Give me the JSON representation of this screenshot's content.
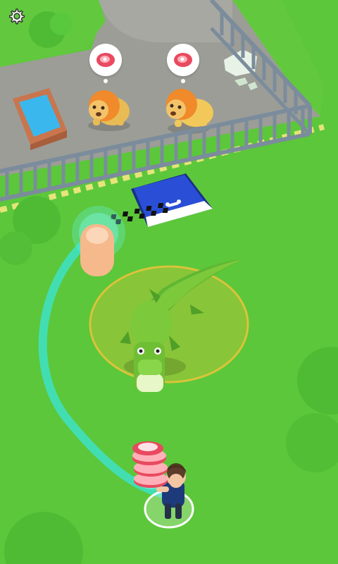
{
  "hud": {
    "settings_icon": "gear-icon"
  },
  "enclosure": {
    "animals": [
      {
        "kind": "lion",
        "request_icon": "meat-icon"
      },
      {
        "kind": "lion",
        "request_icon": "meat-icon"
      }
    ]
  },
  "zones": {
    "feeding_mat_icon": "bone-icon"
  },
  "tutorial": {
    "hint_icon": "finger-pointer-icon"
  },
  "player": {
    "carrying_icon": "meat-stack-icon",
    "carried_count": 3
  },
  "colors": {
    "grass": "#5cc73a",
    "path": "#9c9c95",
    "fence": "#7b8c9c",
    "trail": "#3fe0c0",
    "range_ring": "#d9c43a",
    "crocodile": "#7cc93b",
    "mat": "#2a4fd6"
  }
}
